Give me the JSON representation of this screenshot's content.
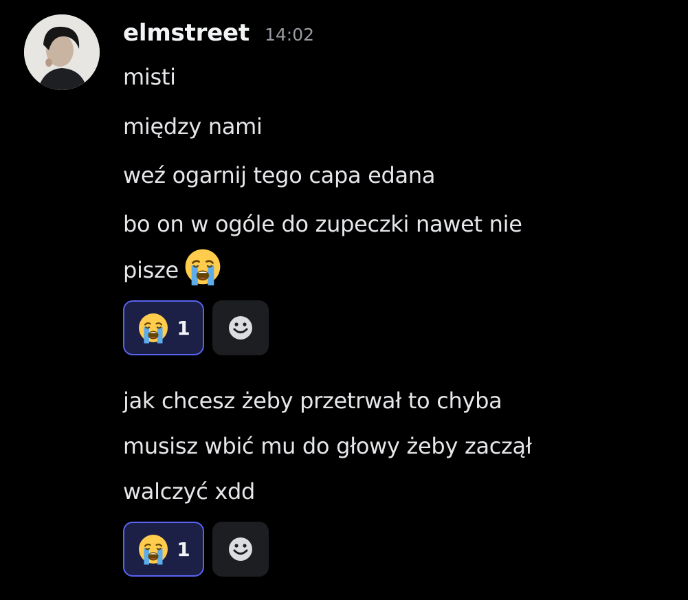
{
  "author": {
    "username": "elmstreet",
    "timestamp": "14:02",
    "avatar_icon": "user-avatar-photo"
  },
  "messages": [
    {
      "text": "misti"
    },
    {
      "text": "między nami"
    },
    {
      "text": "weź ogarnij tego capa edana"
    },
    {
      "line1": "bo on w ogóle do zupeczki nawet nie",
      "line2": "pisze",
      "emoji": "loudly-crying-face"
    },
    {
      "line1": "jak chcesz żeby przetrwał to chyba",
      "line2": "musisz wbić mu do głowy żeby zaczął",
      "line3": "walczyć xdd"
    }
  ],
  "reaction_groups": [
    {
      "emoji": "loudly-crying-face",
      "count": "1",
      "add_icon": "add-reaction-smile-icon"
    },
    {
      "emoji": "loudly-crying-face",
      "count": "1",
      "add_icon": "add-reaction-smile-icon"
    }
  ],
  "colors": {
    "background": "#000000",
    "reaction_border": "#5865f2",
    "reaction_fill": "#1c2046",
    "text": "#e6e7ea",
    "muted": "#9a9ca3"
  }
}
